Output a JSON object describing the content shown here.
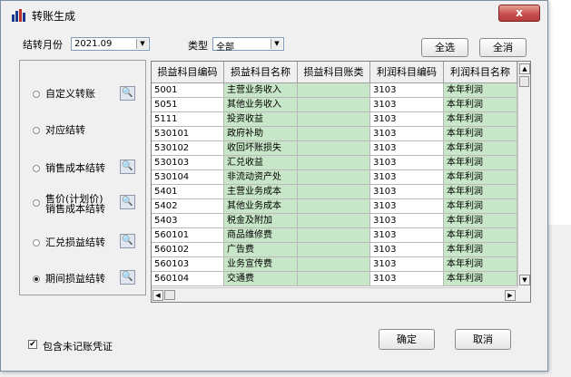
{
  "window": {
    "title": "转账生成",
    "close_label": "x"
  },
  "filters": {
    "month_label": "结转月份",
    "month_value": "2021.09",
    "type_label": "类型",
    "type_value": "全部",
    "select_all": "全选",
    "clear_all": "全消"
  },
  "options": [
    {
      "label": "自定义转账",
      "selected": false
    },
    {
      "label": "对应结转",
      "selected": false
    },
    {
      "label": "销售成本结转",
      "selected": false
    },
    {
      "label": "售价(计划价)销售成本结转",
      "line1": "售价(计划价)",
      "line2": "销售成本结转",
      "selected": false
    },
    {
      "label": "汇兑损益结转",
      "selected": false
    },
    {
      "label": "期间损益结转",
      "selected": true
    }
  ],
  "grid": {
    "columns": [
      "损益科目编码",
      "损益科目名称",
      "损益科目账类",
      "利润科目编码",
      "利润科目名称"
    ],
    "rows": [
      [
        "5001",
        "主营业务收入",
        "",
        "3103",
        "本年利润"
      ],
      [
        "5051",
        "其他业务收入",
        "",
        "3103",
        "本年利润"
      ],
      [
        "5111",
        "投资收益",
        "",
        "3103",
        "本年利润"
      ],
      [
        "530101",
        "政府补助",
        "",
        "3103",
        "本年利润"
      ],
      [
        "530102",
        "收回坏账损失",
        "",
        "3103",
        "本年利润"
      ],
      [
        "530103",
        "汇兑收益",
        "",
        "3103",
        "本年利润"
      ],
      [
        "530104",
        "非流动资产处",
        "",
        "3103",
        "本年利润"
      ],
      [
        "5401",
        "主营业务成本",
        "",
        "3103",
        "本年利润"
      ],
      [
        "5402",
        "其他业务成本",
        "",
        "3103",
        "本年利润"
      ],
      [
        "5403",
        "税金及附加",
        "",
        "3103",
        "本年利润"
      ],
      [
        "560101",
        "商品维修费",
        "",
        "3103",
        "本年利润"
      ],
      [
        "560102",
        "广告费",
        "",
        "3103",
        "本年利润"
      ],
      [
        "560103",
        "业务宣传费",
        "",
        "3103",
        "本年利润"
      ],
      [
        "560104",
        "交通费",
        "",
        "3103",
        "本年利润"
      ]
    ]
  },
  "footer": {
    "include_label": "包含未记账凭证",
    "include_checked": true,
    "ok_label": "确定",
    "cancel_label": "取消"
  },
  "icons": {
    "query": "magnifier-icon",
    "check": "✔"
  }
}
